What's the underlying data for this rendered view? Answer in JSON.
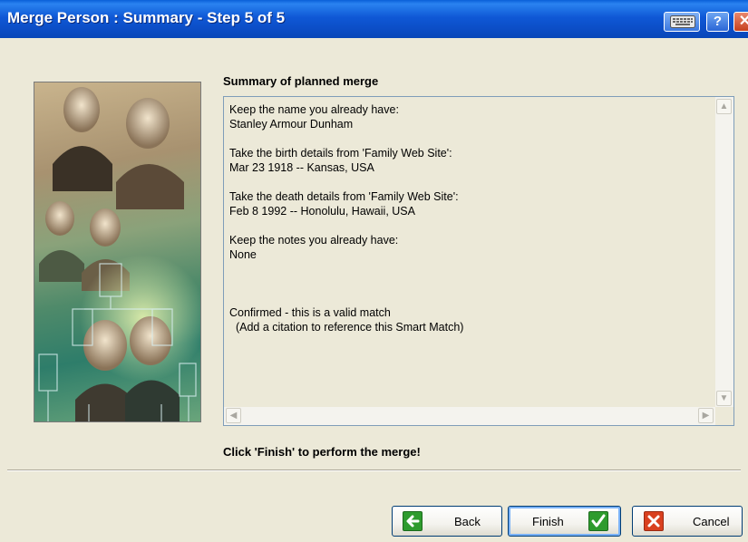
{
  "window": {
    "title": "Merge Person : Summary - Step 5 of 5",
    "help_glyph": "?",
    "close_glyph": "✕"
  },
  "summary": {
    "heading": "Summary of planned merge",
    "text": "Keep the name you already have:\nStanley Armour Dunham\n\nTake the birth details from 'Family Web Site':\nMar 23 1918 -- Kansas, USA\n\nTake the death details from 'Family Web Site':\nFeb 8 1992 -- Honolulu, Hawaii, USA\n\nKeep the notes you already have:\nNone\n\n\n\nConfirmed - this is a valid match\n  (Add a citation to reference this Smart Match)"
  },
  "footer": {
    "message": "Click 'Finish' to perform the merge!"
  },
  "buttons": {
    "back": "Back",
    "finish": "Finish",
    "cancel": "Cancel"
  },
  "colors": {
    "title_bar": "#0b4cc4",
    "back_icon": "#2e9b2e",
    "finish_icon": "#2e9b2e",
    "cancel_icon": "#d9401f"
  }
}
